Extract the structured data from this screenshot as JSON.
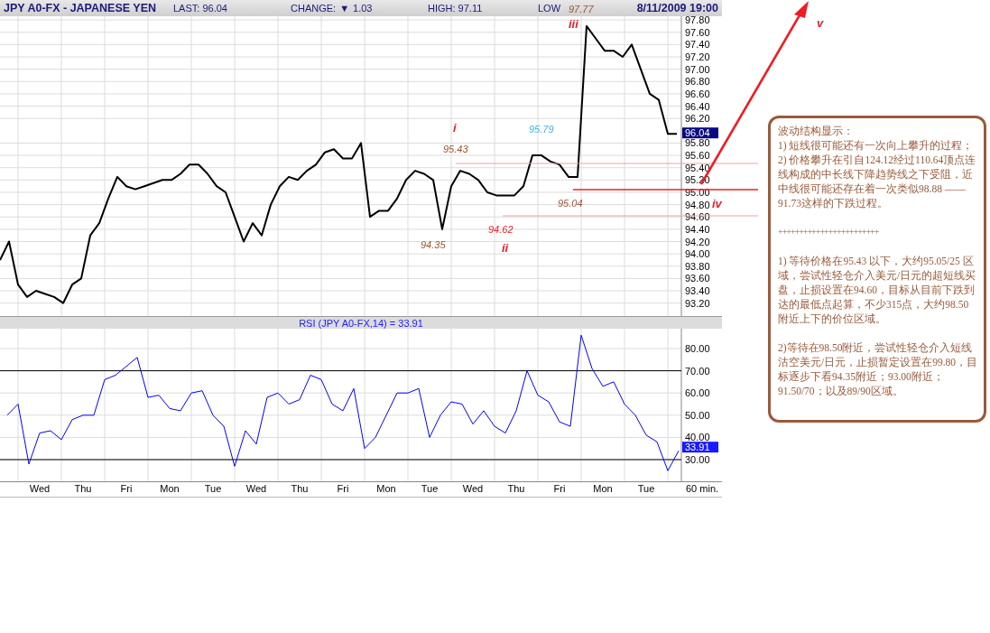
{
  "header": {
    "symbol": "JPY A0-FX - JAPANESE YEN",
    "last": "LAST: 96.04",
    "change_label": "CHANGE:",
    "change_icon": "▼",
    "change_value": "1.03",
    "high": "HIGH: 97.11",
    "low": "LOW",
    "datetime": "8/11/2009 19:00"
  },
  "price_chart": {
    "last_price_tag": "96.04",
    "chart_data": {
      "type": "line",
      "grid": true,
      "series": [
        {
          "color": "#000000",
          "values": [
            93.9,
            94.2,
            93.5,
            93.3,
            93.4,
            93.35,
            93.3,
            93.2,
            93.5,
            93.6,
            94.3,
            94.5,
            94.9,
            95.25,
            95.1,
            95.05,
            95.1,
            95.15,
            95.2,
            95.2,
            95.3,
            95.45,
            95.45,
            95.3,
            95.1,
            95.0,
            94.6,
            94.2,
            94.5,
            94.3,
            94.8,
            95.1,
            95.25,
            95.2,
            95.35,
            95.45,
            95.65,
            95.7,
            95.55,
            95.55,
            95.8,
            94.6,
            94.7,
            94.7,
            94.9,
            95.2,
            95.35,
            95.3,
            95.2,
            94.4,
            95.1,
            95.35,
            95.3,
            95.2,
            95.0,
            94.95,
            94.95,
            94.95,
            95.1,
            95.6,
            95.6,
            95.5,
            95.45,
            95.25,
            95.25,
            97.7,
            97.5,
            97.3,
            97.3,
            97.2,
            97.4,
            97.0,
            96.6,
            96.5,
            95.95,
            95.95
          ]
        }
      ],
      "ylim": [
        92.99,
        97.86
      ],
      "yticks": [
        {
          "value": 93.2,
          "label": "93.20"
        },
        {
          "value": 93.4,
          "label": "93.40"
        },
        {
          "value": 93.6,
          "label": "93.60"
        },
        {
          "value": 93.8,
          "label": "93.80"
        },
        {
          "value": 94.0,
          "label": "94.00"
        },
        {
          "value": 94.2,
          "label": "94.20"
        },
        {
          "value": 94.4,
          "label": "94.40"
        },
        {
          "value": 94.6,
          "label": "94.60"
        },
        {
          "value": 94.8,
          "label": "94.80"
        },
        {
          "value": 95.0,
          "label": "95.00"
        },
        {
          "value": 95.2,
          "label": "95.20"
        },
        {
          "value": 95.4,
          "label": "95.40"
        },
        {
          "value": 95.6,
          "label": "95.60"
        },
        {
          "value": 95.8,
          "label": "95.80"
        },
        {
          "value": 96.2,
          "label": "96.20"
        },
        {
          "value": 96.4,
          "label": "96.40"
        },
        {
          "value": 96.6,
          "label": "96.60"
        },
        {
          "value": 96.8,
          "label": "96.80"
        },
        {
          "value": 97.0,
          "label": "97.00"
        },
        {
          "value": 97.2,
          "label": "97.20"
        },
        {
          "value": 97.4,
          "label": "97.40"
        },
        {
          "value": 97.6,
          "label": "97.60"
        },
        {
          "value": 97.8,
          "label": "97.80"
        }
      ]
    }
  },
  "annotations": [
    {
      "text": "97.77",
      "kind": "price",
      "color": "#a0522d"
    },
    {
      "text": "iii",
      "kind": "wave",
      "color": "#e8202a"
    },
    {
      "text": "i",
      "kind": "wave",
      "color": "#e8202a"
    },
    {
      "text": "95.43",
      "kind": "price",
      "color": "#a0522d"
    },
    {
      "text": "95.79",
      "kind": "price",
      "color": "#33b5ee"
    },
    {
      "text": "95.04",
      "kind": "price",
      "color": "#a0522d"
    },
    {
      "text": "94.35",
      "kind": "price",
      "color": "#a0522d"
    },
    {
      "text": "94.62",
      "kind": "price",
      "color": "#e8202a"
    },
    {
      "text": "ii",
      "kind": "wave",
      "color": "#e8202a"
    },
    {
      "text": "iv",
      "kind": "wave",
      "color": "#e8202a"
    },
    {
      "text": "v",
      "kind": "wave",
      "color": "#e8202a"
    }
  ],
  "rsi_panel": {
    "title": "RSI (JPY A0-FX,14) = 33.91",
    "value_tag": "33.91",
    "chart_data": {
      "type": "line",
      "grid": true,
      "categories": [
        null,
        null,
        null,
        "Wed",
        null,
        null,
        null,
        "Thu",
        null,
        null,
        null,
        "Fri",
        null,
        null,
        null,
        "Mon",
        null,
        null,
        null,
        "Tue",
        null,
        null,
        null,
        "Wed",
        null,
        null,
        null,
        "Thu",
        null,
        null,
        null,
        "Fri",
        null,
        null,
        null,
        "Mon",
        null,
        null,
        null,
        "Tue",
        null,
        null,
        null,
        "Wed",
        null,
        null,
        null,
        "Thu",
        null,
        null,
        null,
        "Fri",
        null,
        null,
        null,
        "Mon",
        null,
        null,
        null,
        "Tue",
        null,
        null,
        null
      ],
      "series": [
        {
          "color": "#0000ff",
          "values": [
            50,
            55,
            28,
            42,
            43,
            39,
            48,
            50,
            50,
            66,
            68,
            72,
            76,
            58,
            59,
            53,
            52,
            60,
            61,
            50,
            45,
            27,
            43,
            37,
            58,
            60,
            55,
            57,
            68,
            66,
            55,
            52,
            62,
            35,
            40,
            50,
            60,
            60,
            62,
            40,
            50,
            56,
            55,
            46,
            52,
            45,
            42,
            52,
            70,
            59,
            56,
            47,
            45,
            86,
            71,
            63,
            65,
            55,
            50,
            41,
            38,
            25,
            34
          ]
        }
      ],
      "ylim": [
        20.24,
        88.94
      ],
      "yticks": [
        {
          "value": 30,
          "label": "30.00"
        },
        {
          "value": 40,
          "label": "40.00"
        },
        {
          "value": 50,
          "label": "50.00"
        },
        {
          "value": 60,
          "label": "60.00"
        },
        {
          "value": 70,
          "label": "70.00"
        },
        {
          "value": 80,
          "label": "80.00"
        }
      ]
    }
  },
  "interval": "60 min.",
  "note": {
    "paragraphs": [
      {
        "kind": "text",
        "text": "波动结构显示："
      },
      {
        "kind": "text",
        "text": "1) 短线很可能还有一次向上攀升的过程；"
      },
      {
        "kind": "text",
        "text": "2) 价格攀升在引自124.12经过110.64顶点连线构成的中长线下降趋势线之下受阻，近中线很可能还存在着一次类似98.88 ——91.73这样的下跌过程。"
      },
      {
        "kind": "separator",
        "text": "++++++++++++++++++++++++"
      },
      {
        "kind": "text",
        "text": "1) 等待价格在95.43 以下，大约95.05/25 区域，尝试性轻仓介入美元/日元的超短线买盘，止损设置在94.60，目标从目前下跌到达的最低点起算，不少315点，大约98.50附近上下的价位区域。"
      },
      {
        "kind": "text",
        "text": "2)等待在98.50附近，尝试性轻仓介入短线沽空美元/日元，止损暂定设置在99.80，目标逐步下看94.35附近；93.00附近；91.50/70；以及89/90区域。"
      }
    ]
  }
}
